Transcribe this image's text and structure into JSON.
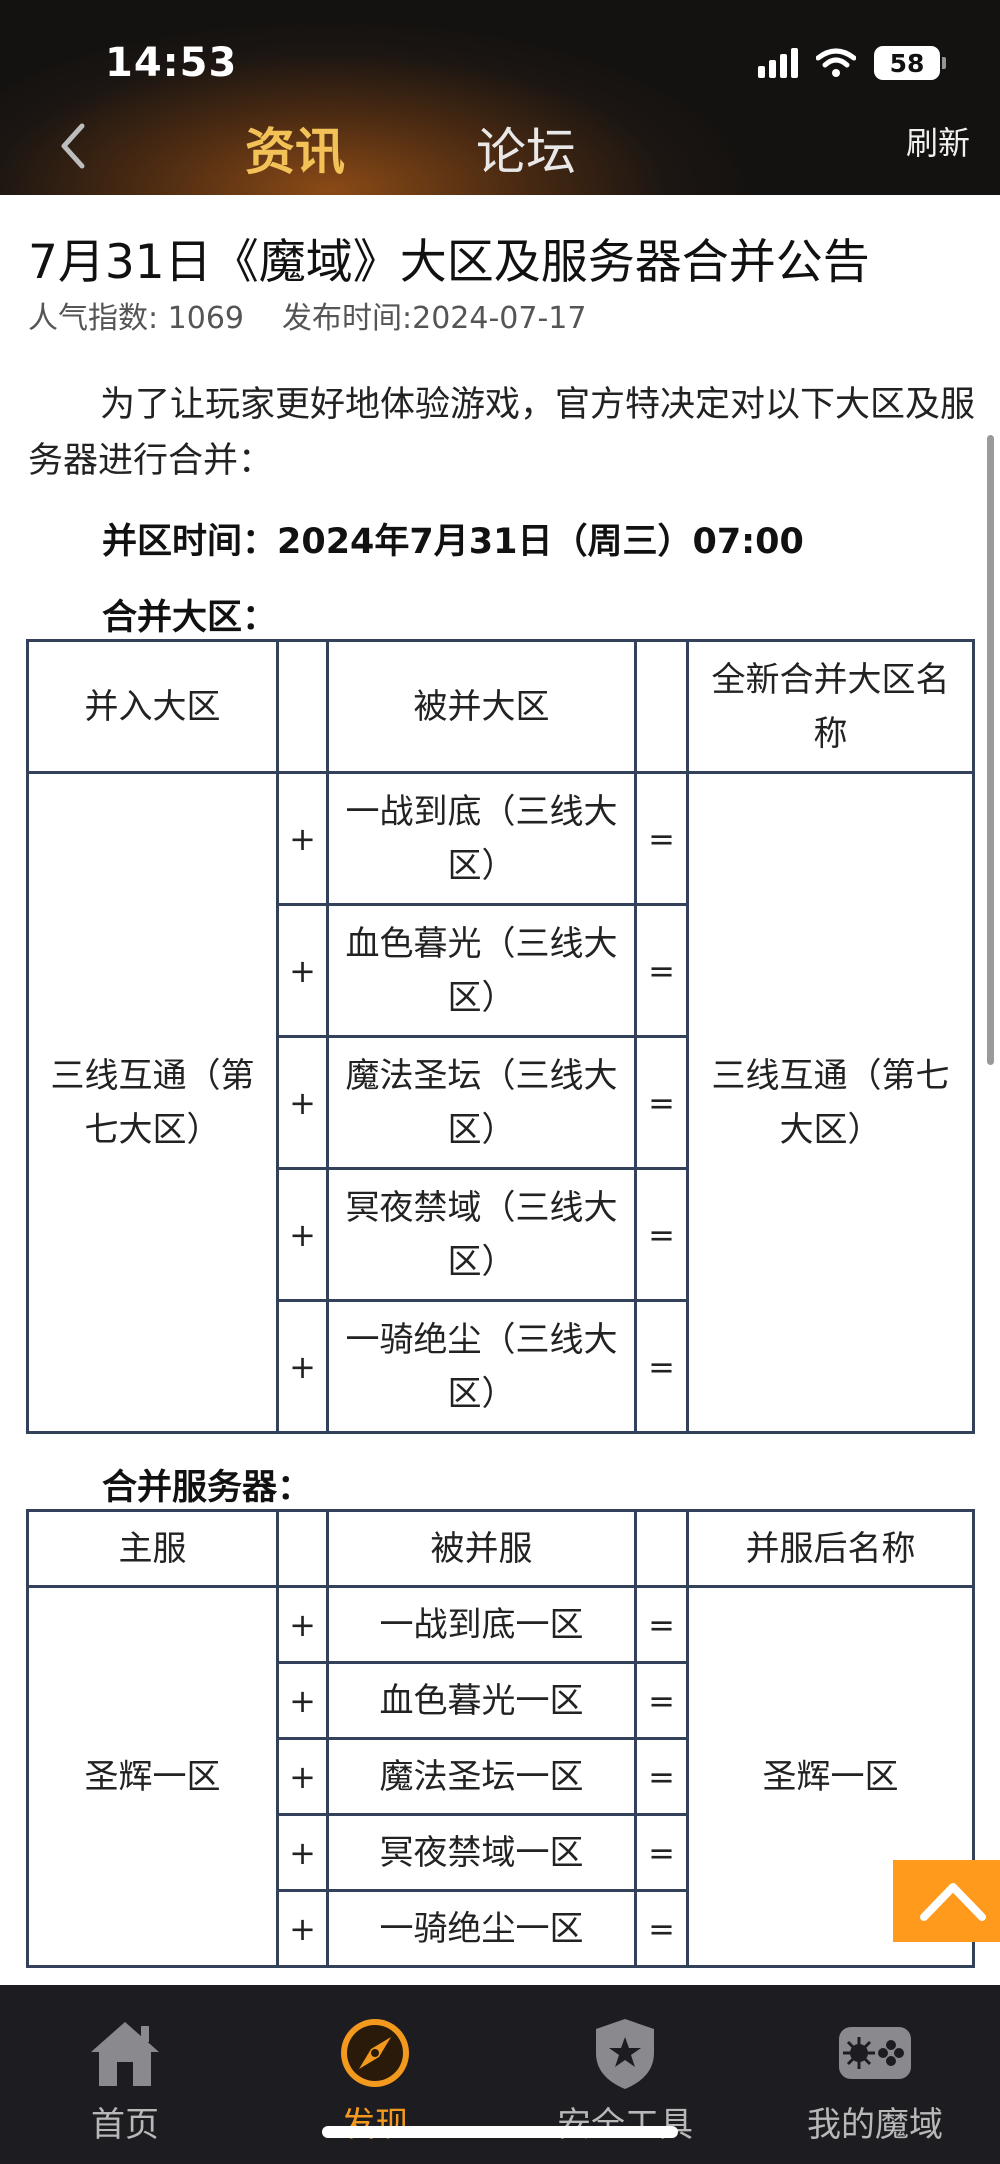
{
  "status_bar": {
    "time": "14:53",
    "battery": "58"
  },
  "header": {
    "tab_news": "资讯",
    "tab_forum": "论坛",
    "refresh": "刷新"
  },
  "article": {
    "title": "7月31日《魔域》大区及服务器合并公告",
    "popularity": "人气指数: 1069",
    "publish_time": "发布时间:2024-07-17",
    "intro": "为了让玩家更好地体验游戏，官方特决定对以下大区及服务器进行合并：",
    "merge_time": "并区时间：2024年7月31日（周三）07:00",
    "region_heading": "合并大区：",
    "server_heading": "合并服务器："
  },
  "region_table": {
    "headers": [
      "并入大区",
      "",
      "被并大区",
      "",
      "全新合并大区名称"
    ],
    "main": "三线互通（第七大区）",
    "merged": [
      "一战到底（三线大区）",
      "血色暮光（三线大区）",
      "魔法圣坛（三线大区）",
      "冥夜禁域（三线大区）",
      "一骑绝尘（三线大区）"
    ],
    "plus": "+",
    "equals": "=",
    "result": "三线互通（第七大区）"
  },
  "server_table": {
    "headers": [
      "主服",
      "",
      "被并服",
      "",
      "并服后名称"
    ],
    "main": "圣辉一区",
    "merged": [
      "一战到底一区",
      "血色暮光一区",
      "魔法圣坛一区",
      "冥夜禁域一区",
      "一骑绝尘一区"
    ],
    "plus": "+",
    "equals": "=",
    "result": "圣辉一区"
  },
  "bottom_nav": {
    "items": [
      {
        "label": "首页",
        "icon": "home-icon"
      },
      {
        "label": "发现",
        "icon": "compass-icon"
      },
      {
        "label": "安全工具",
        "icon": "shield-star-icon"
      },
      {
        "label": "我的魔域",
        "icon": "gamepad-icon"
      }
    ],
    "active_index": 1
  },
  "colors": {
    "accent": "#f39a1e",
    "tab_active": "#f2c258",
    "table_border": "#34415a",
    "to_top": "#ff9a1c"
  }
}
